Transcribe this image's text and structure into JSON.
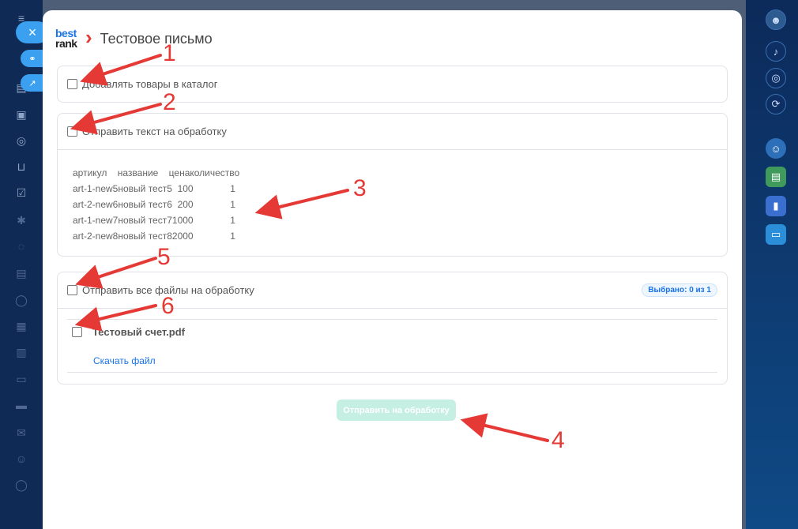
{
  "modal": {
    "title": "Тестовое письмо",
    "logo_line1": "best",
    "logo_line2": "rank"
  },
  "sections": {
    "catalog_label": "Добавлять товары в каталог",
    "text_label": "Отправить текст на обработку",
    "files_label": "Отправить все файлы на обработку",
    "files_badge": "Выбрано: 0 из 1"
  },
  "product_table": {
    "lines": [
      "артикул    название    ценаколичество",
      "art-1-new5новый тест5  100              1",
      "art-2-new6новый тест6  200              1",
      "art-1-new7новый тест71000              1",
      "art-2-new8новый тест82000              1"
    ]
  },
  "file": {
    "name": "Тестовый счет.pdf",
    "download_label": "Скачать файл"
  },
  "submit_label": "Отправить на обработку",
  "annotations": [
    "1",
    "2",
    "3",
    "5",
    "6",
    "4"
  ],
  "icons": {
    "close": "close-icon",
    "link": "link-icon",
    "external": "external-link-icon"
  },
  "colors": {
    "accent": "#1a73e8",
    "annotation": "#e53935",
    "submit_disabled": "#c4efe2"
  }
}
